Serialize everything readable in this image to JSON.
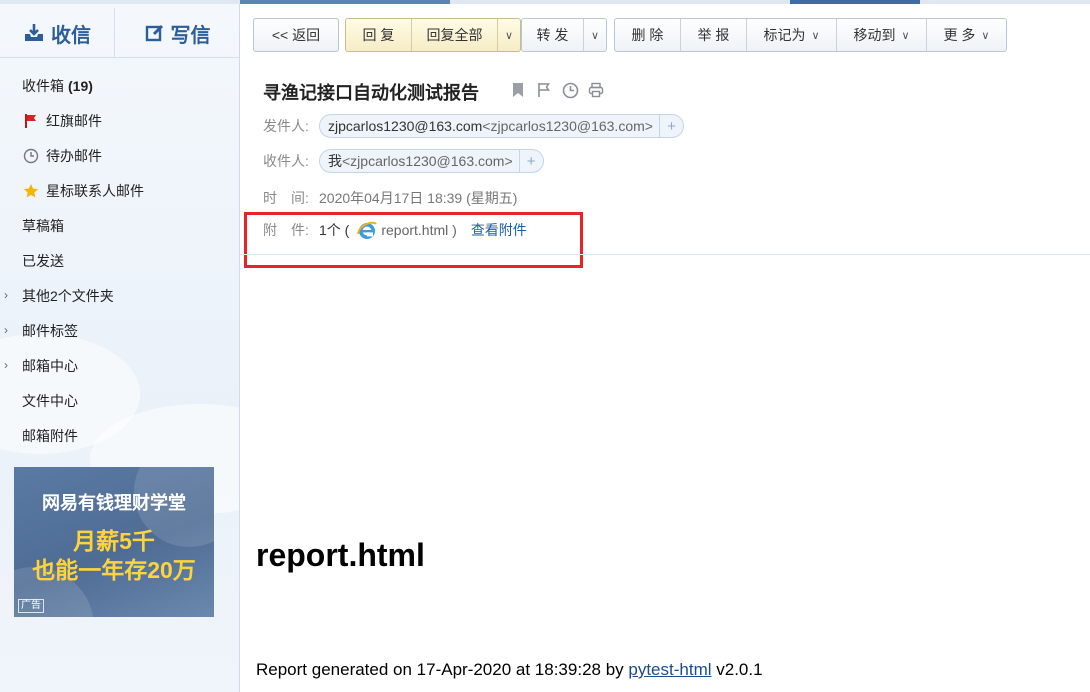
{
  "compose": {
    "receive": "收信",
    "write": "写信"
  },
  "folders": [
    {
      "label": "收件箱",
      "count": "(19)"
    },
    {
      "label": "红旗邮件"
    },
    {
      "label": "待办邮件"
    },
    {
      "label": "星标联系人邮件"
    },
    {
      "label": "草稿箱"
    },
    {
      "label": "已发送"
    },
    {
      "label": "其他2个文件夹"
    },
    {
      "label": "邮件标签"
    },
    {
      "label": "邮箱中心"
    },
    {
      "label": "文件中心"
    },
    {
      "label": "邮箱附件"
    }
  ],
  "ad": {
    "title": "网易有钱理财学堂",
    "line1": "月薪5千",
    "line2": "也能一年存20万",
    "tag": "广告"
  },
  "toolbar": {
    "back": "<< 返回",
    "reply": "回 复",
    "reply_all": "回复全部",
    "forward": "转 发",
    "delete": "删 除",
    "report": "举 报",
    "mark_as": "标记为",
    "move_to": "移动到",
    "more": "更 多"
  },
  "mail": {
    "subject": "寻渔记接口自动化测试报告",
    "from_label": "发件人:",
    "from_name": "zjpcarlos1230@163.com",
    "from_addr": "<zjpcarlos1230@163.com>",
    "to_label": "收件人:",
    "to_name": "我",
    "to_addr": "<zjpcarlos1230@163.com>",
    "time_label": "时　间:",
    "time_value": "2020年04月17日 18:39 (星期五)",
    "att_label": "附　件:",
    "att_count": "1个 (",
    "att_file": "report.html )",
    "att_link": "查看附件"
  },
  "body": {
    "title": "report.html",
    "line_prefix": "Report generated on 17-Apr-2020 at 18:39:28 by ",
    "line_link": "pytest-html",
    "line_suffix": " v2.0.1"
  },
  "colors": {
    "accent": "#2e5e9a",
    "highlight_box": "#e8242b",
    "link": "#1a5fa8"
  }
}
